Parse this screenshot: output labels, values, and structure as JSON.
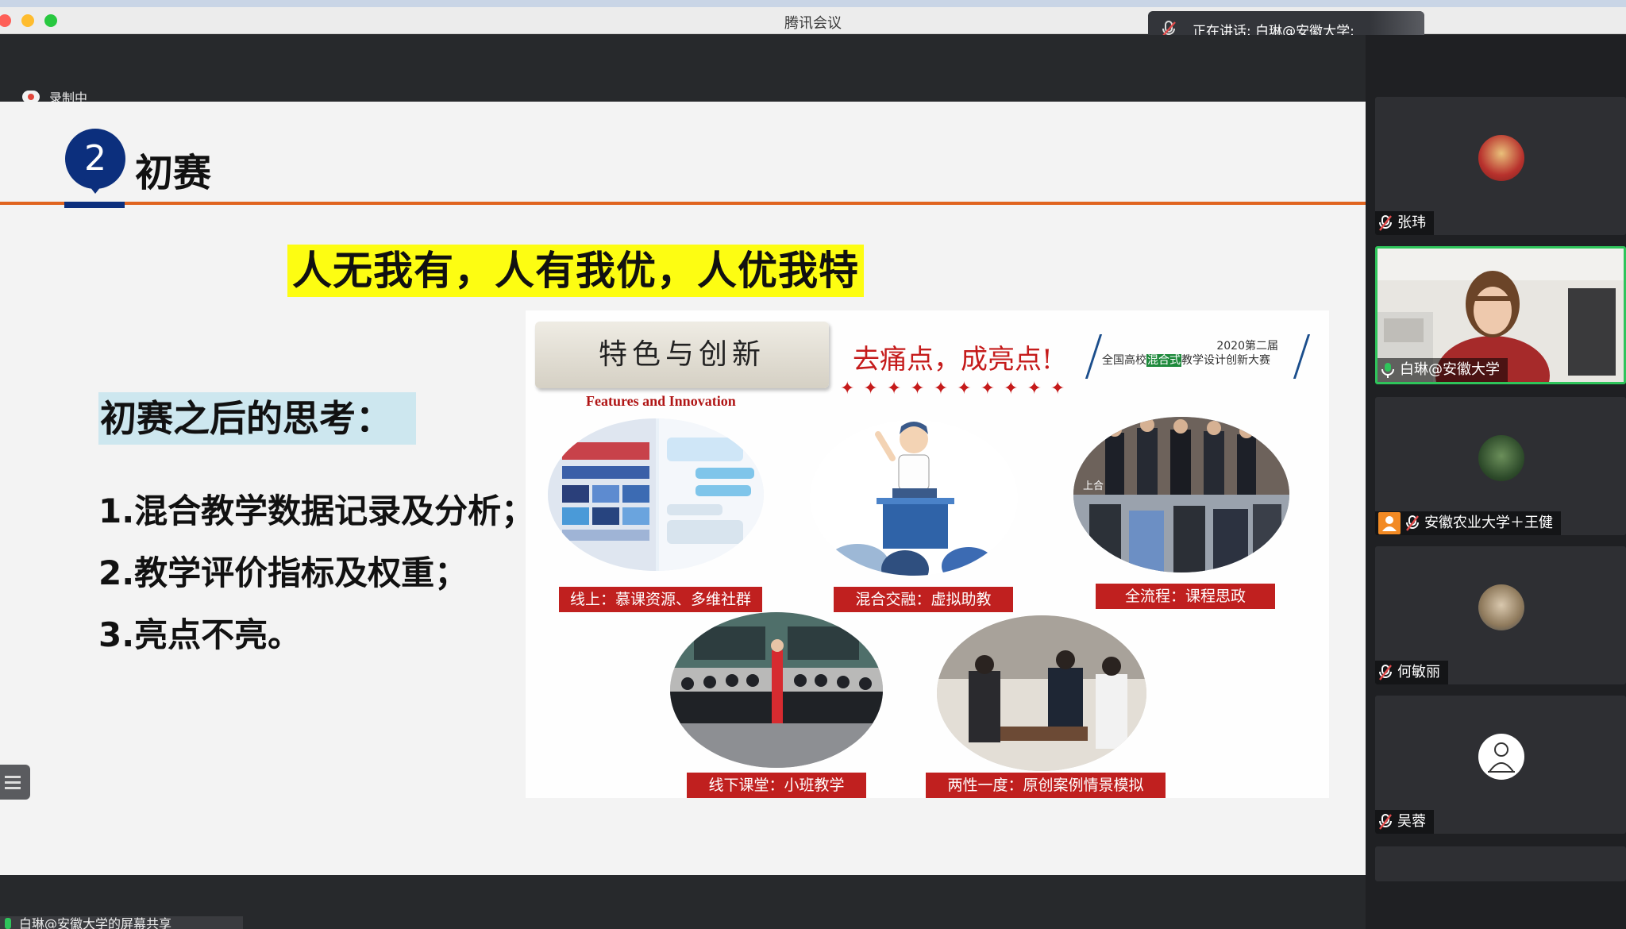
{
  "window": {
    "title": "腾讯会议"
  },
  "speaking": {
    "text": "正在讲话: 白琳@安徽大学;"
  },
  "recording": {
    "label": "录制中"
  },
  "slide": {
    "section_number": "2",
    "title": "初赛",
    "slogan": "人无我有，人有我优，人优我特",
    "thinking_title": "初赛之后的思考：",
    "points": [
      "1.混合教学数据记录及分析；",
      "2.教学评价指标及权重；",
      "3.亮点不亮。"
    ],
    "embedded": {
      "header": "特色与创新",
      "header_en": "Features and Innovation",
      "slogan": "去痛点，成亮点!",
      "contest_year": "2020第二届",
      "contest_name_pre": "全国高校",
      "contest_name_hl": "混合式",
      "contest_name_post": "教学设计创新大赛",
      "stars": "✦✦✦✦✦✦✦✦✦✦",
      "inset_label": "上合",
      "captions": [
        "线上：慕课资源、多维社群",
        "混合交融：虚拟助教",
        "全流程：课程思政",
        "线下课堂：小班教学",
        "两性一度：原创案例情景模拟"
      ]
    }
  },
  "participants": [
    {
      "name": "张玮",
      "muted": true,
      "active": false
    },
    {
      "name": "白琳@安徽大学",
      "muted": false,
      "active": true
    },
    {
      "name": "安徽农业大学＋王健",
      "muted": true,
      "active": false,
      "host": true
    },
    {
      "name": "何敏丽",
      "muted": true,
      "active": false
    },
    {
      "name": "吴蓉",
      "muted": true,
      "active": false
    }
  ],
  "share": {
    "label": "白琳@安徽大学的屏幕共享"
  },
  "colors": {
    "accent_green": "#2fc45b",
    "slide_navy": "#0c2f7d",
    "slide_orange": "#e0641f",
    "caption_red": "#c0201f",
    "highlight_yellow": "#fdfd12"
  }
}
